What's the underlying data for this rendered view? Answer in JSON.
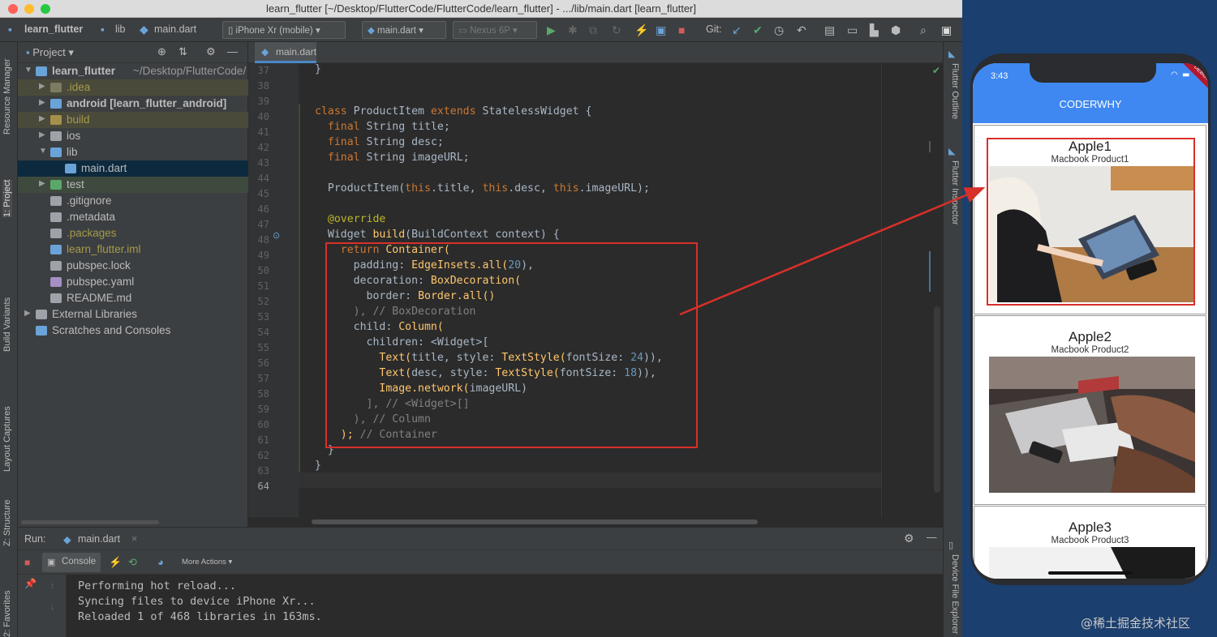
{
  "window": {
    "title": "learn_flutter [~/Desktop/FlutterCode/FlutterCode/learn_flutter] - .../lib/main.dart [learn_flutter]",
    "traffic_colors": [
      "#fe5f57",
      "#febc2e",
      "#28c840"
    ]
  },
  "navbar": {
    "project": "learn_flutter",
    "folder": "lib",
    "file": "main.dart",
    "device_combo": "iPhone Xr (mobile)",
    "config_combo": "main.dart",
    "emulator_combo": "Nexus 6P",
    "git_label": "Git:"
  },
  "left_strip": {
    "resource_manager": "Resource Manager",
    "project": "1: Project",
    "build_variants": "Build Variants",
    "layout_captures": "Layout Captures",
    "structure": "Z: Structure",
    "favorites": "2: Favorites"
  },
  "right_strip": {
    "flutter_outline": "Flutter Outline",
    "flutter_inspector": "Flutter Inspector",
    "device_file_explorer": "Device File Explorer"
  },
  "project_panel": {
    "header": "Project",
    "rows": [
      {
        "label": "learn_flutter",
        "suffix": "~/Desktop/FlutterCode/",
        "color": "#bbbbbb",
        "bold": true
      },
      {
        "label": ".idea",
        "suffix": "",
        "color": "#a59a4b",
        "bold": false
      },
      {
        "label": "android [learn_flutter_android]",
        "suffix": "",
        "color": "#bbbbbb",
        "bold": true
      },
      {
        "label": "build",
        "suffix": "",
        "color": "#a59a4b",
        "bold": false
      },
      {
        "label": "ios",
        "suffix": "",
        "color": "#bbbbbb",
        "bold": false
      },
      {
        "label": "lib",
        "suffix": "",
        "color": "#bbbbbb",
        "bold": false
      },
      {
        "label": "main.dart",
        "suffix": "",
        "color": "#bbbbbb",
        "bold": false
      },
      {
        "label": "test",
        "suffix": "",
        "color": "#bbbbbb",
        "bold": false
      },
      {
        "label": ".gitignore",
        "suffix": "",
        "color": "#bbbbbb",
        "bold": false
      },
      {
        "label": ".metadata",
        "suffix": "",
        "color": "#bbbbbb",
        "bold": false
      },
      {
        "label": ".packages",
        "suffix": "",
        "color": "#a59a4b",
        "bold": false
      },
      {
        "label": "learn_flutter.iml",
        "suffix": "",
        "color": "#a59a4b",
        "bold": false
      },
      {
        "label": "pubspec.lock",
        "suffix": "",
        "color": "#bbbbbb",
        "bold": false
      },
      {
        "label": "pubspec.yaml",
        "suffix": "",
        "color": "#bbbbbb",
        "bold": false
      },
      {
        "label": "README.md",
        "suffix": "",
        "color": "#bbbbbb",
        "bold": false
      },
      {
        "label": "External Libraries",
        "suffix": "",
        "color": "#bbbbbb",
        "bold": false
      },
      {
        "label": "Scratches and Consoles",
        "suffix": "",
        "color": "#bbbbbb",
        "bold": false
      }
    ]
  },
  "editor": {
    "tab": "main.dart",
    "line_numbers": [
      "37",
      "38",
      "39",
      "40",
      "41",
      "42",
      "43",
      "44",
      "45",
      "46",
      "47",
      "48",
      "49",
      "50",
      "51",
      "52",
      "53",
      "54",
      "55",
      "56",
      "57",
      "58",
      "59",
      "60",
      "61",
      "62",
      "63",
      "64"
    ]
  },
  "code": {
    "l37": "}",
    "l40_kw1": "class",
    "l40_name": "ProductItem",
    "l40_kw2": "extends",
    "l40_base": "StatelessWidget {",
    "l41_kw": "final",
    "l41_rest": "String title;",
    "l42_kw": "final",
    "l42_rest": "String desc;",
    "l43_kw": "final",
    "l43_rest": "String imageURL;",
    "l45_fn": "ProductItem(",
    "l45_t1": "this",
    "l45_p1": ".title, ",
    "l45_t2": "this",
    "l45_p2": ".desc, ",
    "l45_t3": "this",
    "l45_p3": ".imageURL);",
    "l47": "@override",
    "l48_a": "Widget ",
    "l48_fn": "build",
    "l48_b": "(BuildContext context) {",
    "l49_kw": "return",
    "l49_fn": "Container(",
    "l50_a": "padding: ",
    "l50_fn": "EdgeInsets.all(",
    "l50_num": "20",
    "l50_b": "),",
    "l51_a": "decoration: ",
    "l51_fn": "BoxDecoration(",
    "l52_a": "border: ",
    "l52_fn": "Border.all()",
    "l53_a": "), ",
    "l53_cm": "// BoxDecoration",
    "l54_a": "child: ",
    "l54_fn": "Column(",
    "l55": "children: <Widget>[",
    "l56_fn": "Text(",
    "l56_a": "title, style: ",
    "l56_fn2": "TextStyle(",
    "l56_b": "fontSize: ",
    "l56_num": "24",
    "l56_c": ")),",
    "l57_fn": "Text(",
    "l57_a": "desc, style: ",
    "l57_fn2": "TextStyle(",
    "l57_b": "fontSize: ",
    "l57_num": "18",
    "l57_c": ")),",
    "l58_fn": "Image.network(",
    "l58_a": "imageURL)",
    "l59_a": "], ",
    "l59_cm": "// <Widget>[]",
    "l60_a": "), ",
    "l60_cm": "// Column",
    "l61_a": "); ",
    "l61_cm": "// Container",
    "l62": "}",
    "l63": "}"
  },
  "run_panel": {
    "run_label": "Run:",
    "run_tab": "main.dart",
    "console_tab": "Console",
    "more_actions": "More Actions",
    "console_lines": [
      "Performing hot reload...",
      "Syncing files to device iPhone Xr...",
      "Reloaded 1 of 468 libraries in 163ms."
    ]
  },
  "phone": {
    "time": "3:43",
    "app_title": "CODERWHY",
    "debug": "DEBUG",
    "accent": "#3f88f1",
    "products": [
      {
        "title": "Apple1",
        "desc": "Macbook Product1"
      },
      {
        "title": "Apple2",
        "desc": "Macbook Product2"
      },
      {
        "title": "Apple3",
        "desc": "Macbook Product3"
      }
    ]
  },
  "watermark": "@稀土掘金技术社区"
}
